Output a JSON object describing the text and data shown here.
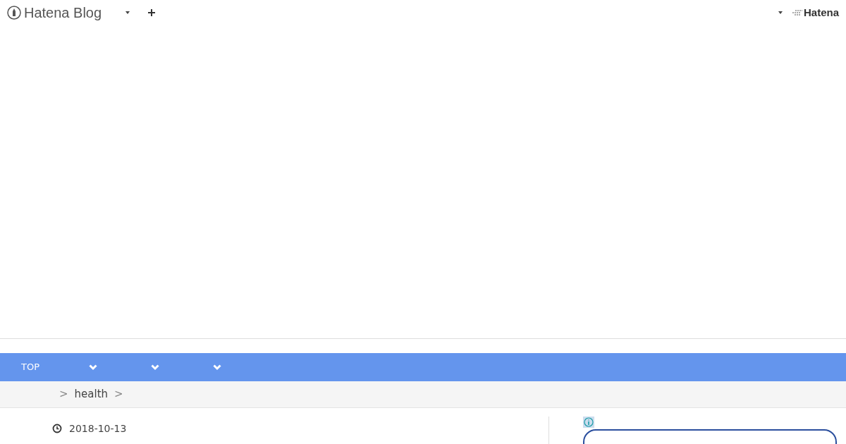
{
  "header": {
    "brand": "Hatena Blog",
    "right_brand": "Hatena"
  },
  "nav": {
    "items": [
      {
        "kind": "link",
        "label": "TOP"
      },
      {
        "kind": "dropdown"
      },
      {
        "kind": "dropdown"
      },
      {
        "kind": "dropdown"
      }
    ]
  },
  "breadcrumb": [
    {
      "kind": "separator",
      "text": ">"
    },
    {
      "kind": "link",
      "text": "health"
    },
    {
      "kind": "separator",
      "text": ">"
    }
  ],
  "entry": {
    "date": "2018-10-13"
  }
}
